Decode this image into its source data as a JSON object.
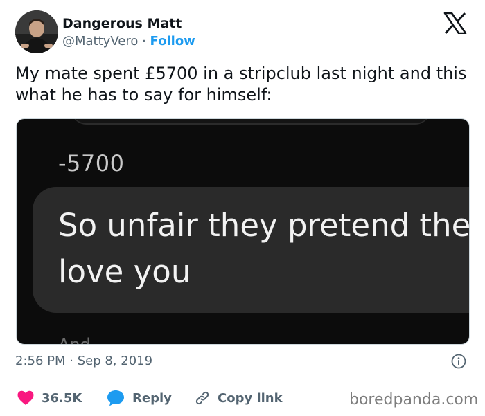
{
  "author": {
    "display_name": "Dangerous Matt",
    "handle": "@MattyVero",
    "separator": "·",
    "follow_label": "Follow"
  },
  "tweet": {
    "text": "My mate spent £5700 in a stripclub last night and this what he has to say for himself:"
  },
  "media": {
    "amount_text": "-5700",
    "message_line_1": "So unfair they pretend the",
    "message_line_2": "love you",
    "cut_off_text": "And"
  },
  "meta": {
    "timestamp": "2:56 PM · Sep 8, 2019"
  },
  "actions": {
    "like_count": "36.5K",
    "reply_label": "Reply",
    "copy_link_label": "Copy link"
  },
  "watermark": {
    "text": "boredpanda.com"
  },
  "icons": {
    "logo": "x-logo-icon",
    "info": "info-icon",
    "like": "heart-icon",
    "reply": "speech-bubble-icon",
    "copy": "link-icon"
  },
  "colors": {
    "accent": "#1d9bf0",
    "like": "#f91880",
    "text_primary": "#0f1419",
    "text_secondary": "#536471",
    "media_background": "#0c0c0c",
    "message_bubble": "#2a2a2a"
  }
}
